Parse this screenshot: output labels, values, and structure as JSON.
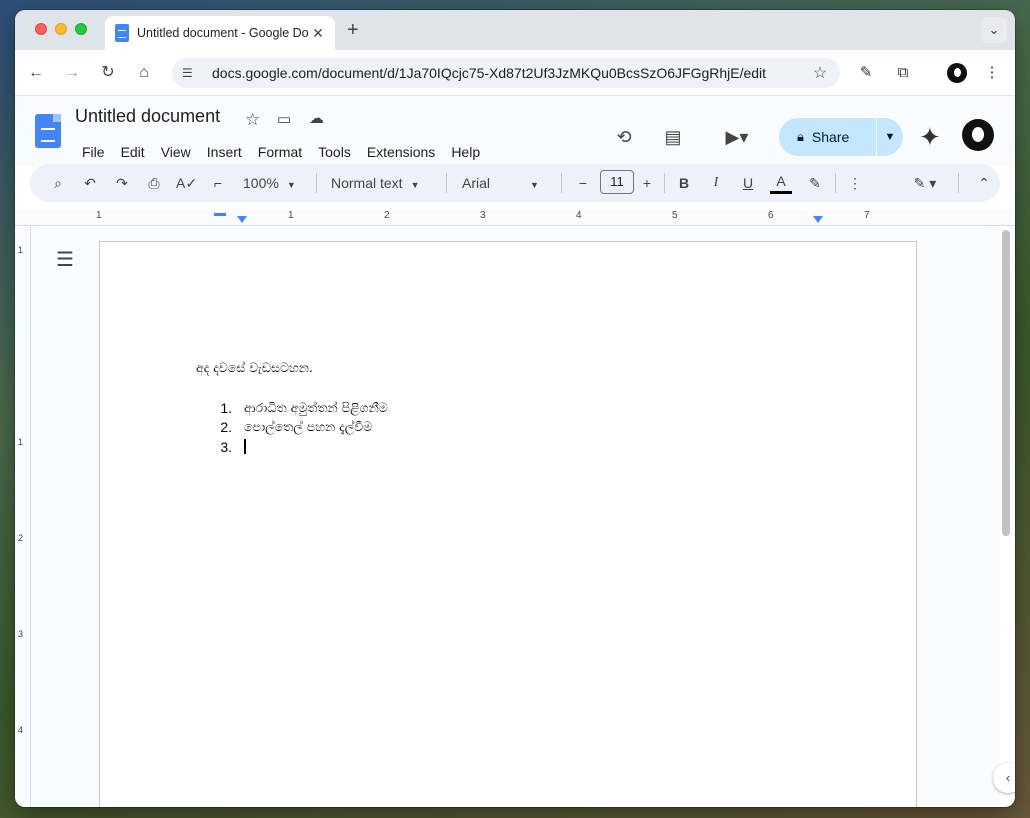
{
  "browser": {
    "tab_title": "Untitled document - Google Docs",
    "url": "docs.google.com/document/d/1Ja70IQcjc75-Xd87t2Uf3JzMKQu0BcsSzO6JFGgRhjE/edit",
    "icons": [
      "back-icon",
      "forward-icon",
      "reload-icon",
      "home-icon",
      "site-info-icon",
      "bookmark-star-icon",
      "pen-icon",
      "extensions-icon",
      "profile-avatar",
      "chrome-menu-icon"
    ]
  },
  "docs": {
    "title": "Untitled document",
    "menu": [
      "File",
      "Edit",
      "View",
      "Insert",
      "Format",
      "Tools",
      "Extensions",
      "Help"
    ],
    "share_label": "Share",
    "accent_color": "#c2e7ff"
  },
  "format_toolbar": {
    "zoom": "100%",
    "style": "Normal text",
    "font": "Arial",
    "font_size": "11"
  },
  "ruler": {
    "horizontal_labels": [
      "1",
      "1",
      "2",
      "3",
      "4",
      "5",
      "6",
      "7"
    ],
    "vertical_labels": [
      "1",
      "1",
      "2",
      "3",
      "4"
    ]
  },
  "document": {
    "heading": "අද දවසේ වැඩසටහන.",
    "list": [
      {
        "num": "1.",
        "text": "ආරාධිත අමුත්තන් පිළිගනීම"
      },
      {
        "num": "2.",
        "text": "පොල්තෙල් පහන දැල්වීම"
      },
      {
        "num": "3.",
        "text": ""
      }
    ]
  }
}
